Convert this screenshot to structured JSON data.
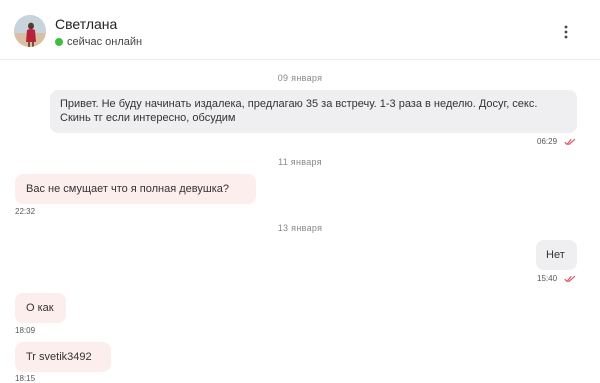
{
  "header": {
    "contact_name": "Светлана",
    "status_text": "сейчас онлайн",
    "status_color": "#3fbf3f",
    "menu_icon": "more-vertical-icon"
  },
  "messages": {
    "dates": [
      "09 января",
      "11 января",
      "13 января"
    ],
    "items": [
      {
        "direction": "outgoing",
        "text": "Привет. Не буду начинать издалека, предлагаю 35 за встречу. 1-3 раза в неделю. Досуг, секс. Скинь тг если интересно, обсудим",
        "time": "06:29",
        "read_icon": "double-check-icon"
      },
      {
        "direction": "incoming",
        "text": "Вас не смущает что я полная девушка?",
        "time": "22:32"
      },
      {
        "direction": "outgoing",
        "text": "Нет",
        "time": "15:40",
        "read_icon": "double-check-icon"
      },
      {
        "direction": "incoming",
        "text": "О как",
        "time": "18:09"
      },
      {
        "direction": "incoming",
        "text": "Tr svetik3492",
        "time": "18:15"
      }
    ]
  },
  "colors": {
    "outgoing_bubble": "#efeff1",
    "incoming_bubble": "#fdeeee",
    "read_check": "#e0556a"
  }
}
